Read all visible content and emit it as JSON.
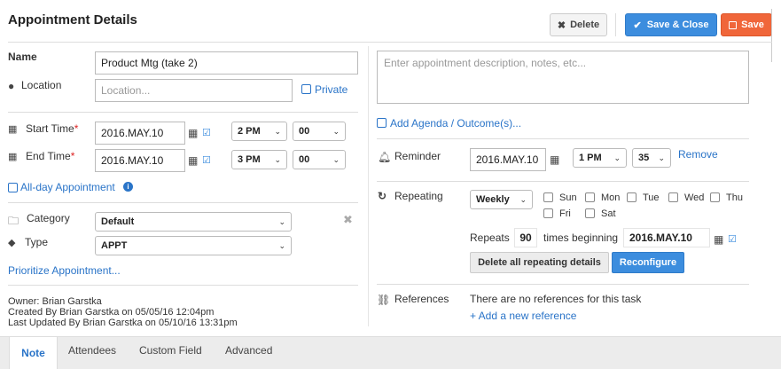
{
  "header": {
    "title": "Appointment Details",
    "delete_label": "Delete",
    "save_close_label": "Save & Close",
    "save_label": "Save"
  },
  "left": {
    "name_label": "Name",
    "name_value": "Product Mtg (take 2)",
    "location_label": "Location",
    "location_placeholder": "Location...",
    "private_label": "Private",
    "start_label": "Start Time",
    "start_date": "2016.MAY.10",
    "start_hour": "2 PM",
    "start_min": "00",
    "end_label": "End Time",
    "end_date": "2016.MAY.10",
    "end_hour": "3 PM",
    "end_min": "00",
    "required_mark": "*",
    "allday_label": "All-day Appointment",
    "category_label": "Category",
    "category_value": "Default",
    "type_label": "Type",
    "type_value": "APPT",
    "prioritize_label": "Prioritize Appointment...",
    "owner": "Owner: Brian Garstka",
    "created": "Created By Brian Garstka on 05/05/16 12:04pm",
    "updated": "Last Updated By Brian Garstka on 05/10/16 13:31pm"
  },
  "right": {
    "description_placeholder": "Enter appointment description, notes, etc...",
    "agenda_label": "Add Agenda / Outcome(s)...",
    "reminder_label": "Reminder",
    "reminder_date": "2016.MAY.10",
    "reminder_hour": "1 PM",
    "reminder_min": "35",
    "remove_label": "Remove",
    "repeating_label": "Repeating",
    "repeat_freq": "Weekly",
    "days": [
      "Sun",
      "Mon",
      "Tue",
      "Wed",
      "Thu",
      "Fri",
      "Sat"
    ],
    "repeats_label": "Repeats",
    "repeats_value": "90",
    "times_beginning_label": "times beginning",
    "repeat_begin_date": "2016.MAY.10",
    "delete_repeating_label": "Delete all repeating details",
    "reconfigure_label": "Reconfigure",
    "references_label": "References",
    "no_references": "There are no references for this task",
    "add_reference": "+ Add a new reference"
  },
  "tabs": [
    "Note",
    "Attendees",
    "Custom Field",
    "Advanced"
  ],
  "colors": {
    "accent": "#3c8dde",
    "save": "#f0663a",
    "link": "#2a74c8"
  }
}
